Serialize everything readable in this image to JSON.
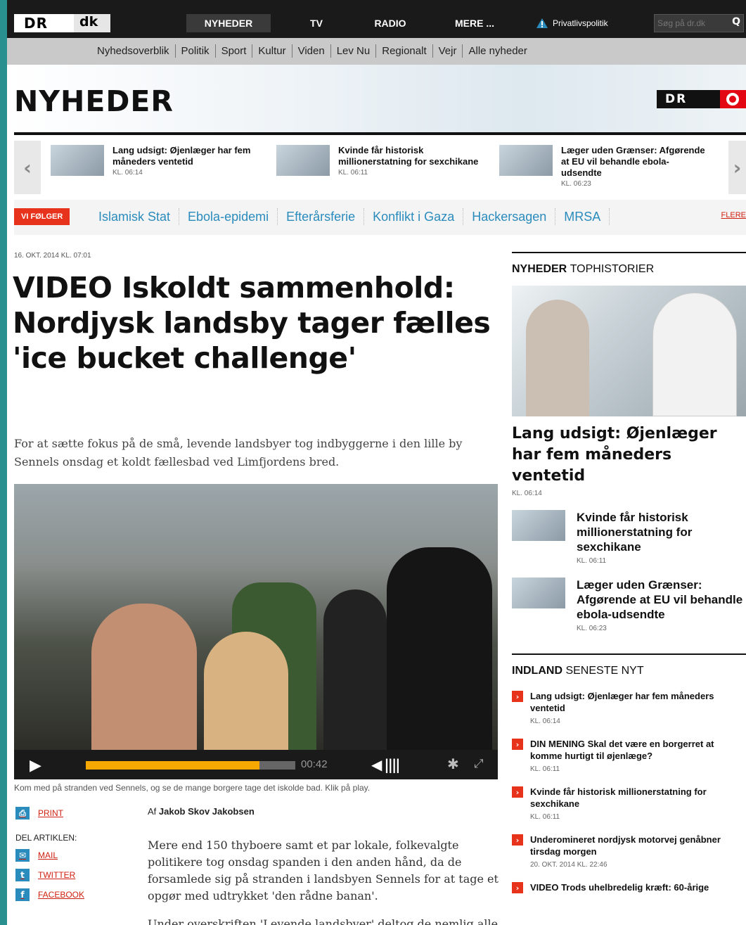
{
  "topbar": {
    "logo_dr": "DR",
    "logo_dk": "dk",
    "nav": [
      "NYHEDER",
      "TV",
      "RADIO",
      "MERE ..."
    ],
    "privacy": "Privatlivspolitik",
    "search_placeholder": "Søg på dr.dk"
  },
  "subnav": [
    "Nyhedsoverblik",
    "Politik",
    "Sport",
    "Kultur",
    "Viden",
    "Lev Nu",
    "Regionalt",
    "Vejr",
    "Alle nyheder"
  ],
  "banner": {
    "title": "NYHEDER",
    "logo": "DR"
  },
  "carousel": [
    {
      "title": "Lang udsigt: Øjenlæger har fem måneders ventetid",
      "time": "KL. 06:14"
    },
    {
      "title": "Kvinde får historisk millionerstatning for sexchikane",
      "time": "KL. 06:11"
    },
    {
      "title": "Læger uden Grænser: Afgørende at EU vil behandle ebola-udsendte",
      "time": "KL. 06:23"
    }
  ],
  "follow": {
    "label": "VI FØLGER",
    "tags": [
      "Islamisk Stat",
      "Ebola-epidemi",
      "Efterårsferie",
      "Konflikt i Gaza",
      "Hackersagen",
      "MRSA"
    ],
    "more": "FLERE"
  },
  "article": {
    "date": "16. OKT. 2014 KL. 07:01",
    "headline": "VIDEO Iskoldt sammenhold: Nordjysk landsby tager fælles 'ice bucket challenge'",
    "lede": "For at sætte fokus på de små, levende landsbyer tog indbyggerne i den lille by Sennels onsdag et koldt fællesbad ved Limfjordens bred.",
    "video": {
      "time": "00:42",
      "progress": 0.83
    },
    "caption": "Kom med på stranden ved Sennels, og se de mange borgere tage det iskolde bad. Klik på play.",
    "print": "PRINT",
    "share_label": "DEL ARTIKLEN:",
    "share": [
      "MAIL",
      "TWITTER",
      "FACEBOOK"
    ],
    "author_prefix": "Af",
    "author": "Jakob Skov Jakobsen",
    "body": [
      "Mere end 150 thyboere samt et par lokale, folkevalgte politikere tog onsdag spanden i den anden hånd, da de forsamlede sig på stranden i landsbyen Sennels for at tage et opgør med udtrykket 'den rådne banan'.",
      "Under overskriften 'Levende landsbyer' deltog de nemlig alle"
    ]
  },
  "sidebar": {
    "top_heading_bold": "NYHEDER",
    "top_heading": "TOPHISTORIER",
    "top_title": "Lang udsigt: Øjenlæger har fem måneders ventetid",
    "top_time": "KL. 06:14",
    "small": [
      {
        "title": "Kvinde får historisk millionerstatning for sexchikane",
        "time": "KL. 06:11"
      },
      {
        "title": "Læger uden Grænser: Afgørende at EU vil behandle ebola-udsendte",
        "time": "KL. 06:23"
      }
    ],
    "latest_heading_bold": "INDLAND",
    "latest_heading": "SENESTE NYT",
    "latest": [
      {
        "title": "Lang udsigt: Øjenlæger har fem måneders ventetid",
        "time": "KL. 06:14"
      },
      {
        "title": "DIN MENING Skal det være en borgerret at komme hurtigt til øjenlæge?",
        "time": "KL. 06:11"
      },
      {
        "title": "Kvinde får historisk millionerstatning for sexchikane",
        "time": "KL. 06:11"
      },
      {
        "title": "Underomineret nordjysk motorvej genåbner tirsdag morgen",
        "time": "20. OKT. 2014 KL. 22:46"
      },
      {
        "title": "VIDEO Trods uhelbredelig kræft: 60-årige",
        "time": ""
      }
    ]
  }
}
